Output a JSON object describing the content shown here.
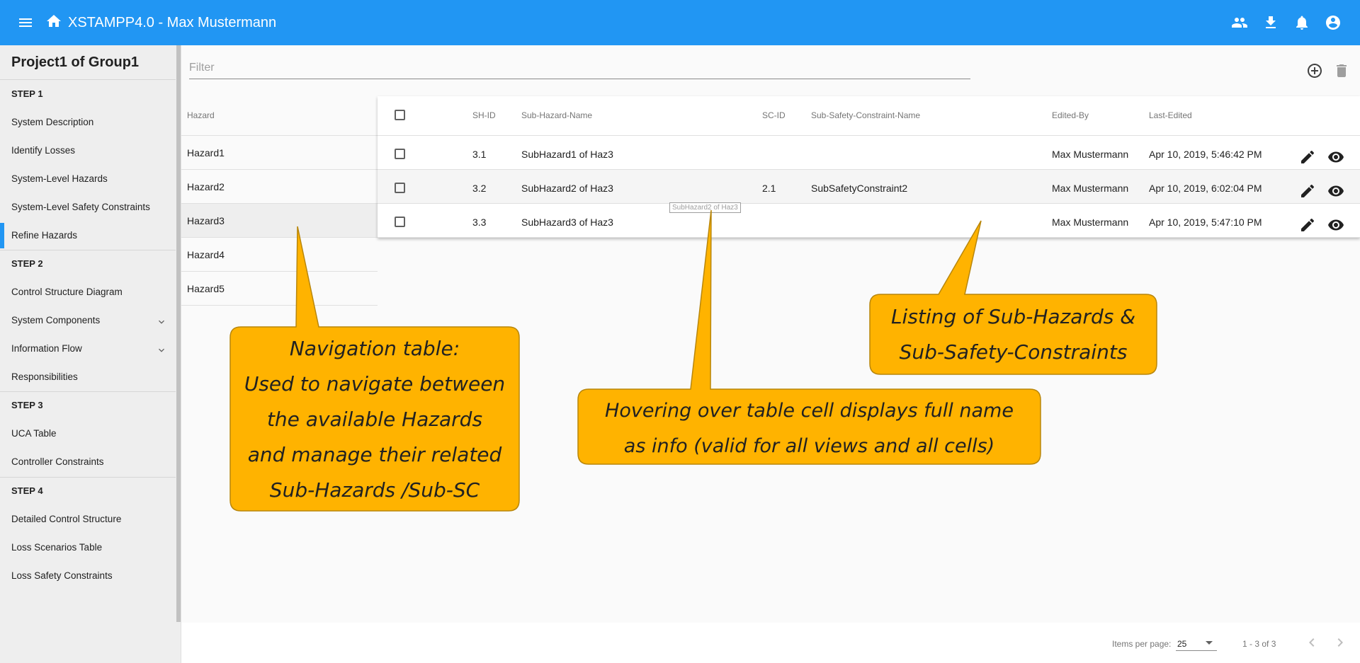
{
  "app": {
    "title": "XSTAMPP4.0 - Max Mustermann",
    "icons": [
      "menu-icon",
      "home-icon",
      "group-icon",
      "download-icon",
      "notifications-icon",
      "account-icon"
    ]
  },
  "sidebar": {
    "project_title": "Project1 of Group1",
    "steps": [
      {
        "label": "STEP 1",
        "items": [
          {
            "label": "System Description"
          },
          {
            "label": "Identify Losses"
          },
          {
            "label": "System-Level Hazards"
          },
          {
            "label": "System-Level Safety Constraints"
          },
          {
            "label": "Refine Hazards",
            "active": true
          }
        ]
      },
      {
        "label": "STEP 2",
        "items": [
          {
            "label": "Control Structure Diagram"
          },
          {
            "label": "System Components",
            "expandable": true
          },
          {
            "label": "Information Flow",
            "expandable": true
          },
          {
            "label": "Responsibilities"
          }
        ]
      },
      {
        "label": "STEP 3",
        "items": [
          {
            "label": "UCA Table"
          },
          {
            "label": "Controller Constraints"
          }
        ]
      },
      {
        "label": "STEP 4",
        "items": [
          {
            "label": "Detailed Control Structure"
          },
          {
            "label": "Loss Scenarios Table"
          },
          {
            "label": "Loss Safety Constraints"
          }
        ]
      }
    ]
  },
  "filter": {
    "placeholder": "Filter"
  },
  "hazard_table": {
    "header": "Hazard",
    "rows": [
      "Hazard1",
      "Hazard2",
      "Hazard3",
      "Hazard4",
      "Hazard5"
    ],
    "selected_index": 2
  },
  "sub_table": {
    "headers": {
      "sh_id": "SH-ID",
      "sub_hazard_name": "Sub-Hazard-Name",
      "sc_id": "SC-ID",
      "sub_sc_name": "Sub-Safety-Constraint-Name",
      "edited_by": "Edited-By",
      "last_edited": "Last-Edited"
    },
    "rows": [
      {
        "sh_id": "3.1",
        "sub_hazard_name": "SubHazard1 of Haz3",
        "sc_id": "",
        "sub_sc_name": "",
        "edited_by": "Max Mustermann",
        "last_edited": "Apr 10, 2019, 5:46:42 PM"
      },
      {
        "sh_id": "3.2",
        "sub_hazard_name": "SubHazard2 of Haz3",
        "sc_id": "2.1",
        "sub_sc_name": "SubSafetyConstraint2",
        "edited_by": "Max Mustermann",
        "last_edited": "Apr 10, 2019, 6:02:04 PM"
      },
      {
        "sh_id": "3.3",
        "sub_hazard_name": "SubHazard3 of Haz3",
        "sc_id": "",
        "sub_sc_name": "",
        "edited_by": "Max Mustermann",
        "last_edited": "Apr 10, 2019, 5:47:10 PM"
      }
    ],
    "tooltip": "SubHazard2 of Haz3"
  },
  "paginator": {
    "items_per_page_label": "Items per page:",
    "items_per_page_value": "25",
    "range_label": "1 - 3 of 3"
  },
  "callouts": {
    "navigation": [
      "Navigation table:",
      "Used to navigate between",
      "the available Hazards",
      "and manage their related",
      "Sub-Hazards /Sub-SC"
    ],
    "hovering": [
      "Hovering over table cell displays full name",
      "as info (valid for all views and all cells)"
    ],
    "listing": [
      "Listing of Sub-Hazards &",
      "Sub-Safety-Constraints"
    ]
  },
  "colors": {
    "primary": "#2196f3",
    "callout_fill": "#ffb300",
    "callout_stroke": "#b8860b"
  }
}
